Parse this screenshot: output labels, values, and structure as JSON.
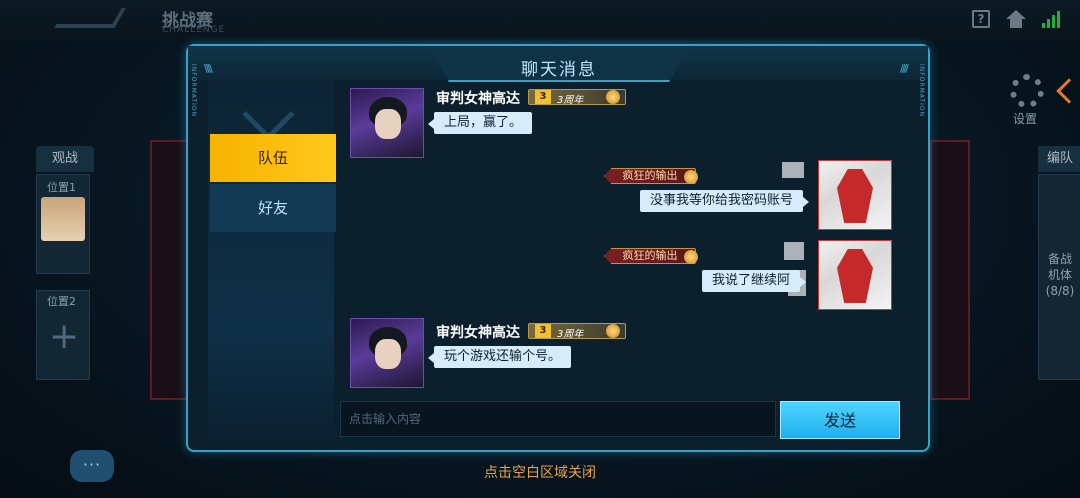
{
  "topbar": {
    "title": "挑战赛",
    "subtitle": "CHALLENGE",
    "help_label": "?",
    "signal_label": "82"
  },
  "left_panel": {
    "title": "观战",
    "slot1": "位置1",
    "slot2": "位置2"
  },
  "right_panel": {
    "title": "编队",
    "spare_label": "备战机体",
    "spare_count": "(8/8)",
    "settings_label": "设置"
  },
  "dialog": {
    "title": "聊天消息",
    "tabs": [
      {
        "label": "队伍",
        "active": true
      },
      {
        "label": "好友",
        "active": false
      }
    ],
    "messages": [
      {
        "sender": "审判女神高达",
        "badge_level": "3",
        "badge_text": "3周年",
        "text": "上局，赢了。",
        "side": "left"
      },
      {
        "badge_text": "疯狂的输出",
        "text": "没事我等你给我密码账号",
        "side": "right"
      },
      {
        "badge_text": "疯狂的输出",
        "text": "我说了继续阿",
        "side": "right"
      },
      {
        "sender": "审判女神高达",
        "badge_level": "3",
        "badge_text": "3周年",
        "text": "玩个游戏还输个号。",
        "side": "left"
      }
    ],
    "input_placeholder": "点击输入内容",
    "send_label": "发送"
  },
  "footer_hint": "点击空白区域关闭",
  "chat_icon_label": "···",
  "colors": {
    "accent": "#3aa0c6",
    "active_tab": "#f6b300",
    "send_button": "#2fc0f5",
    "hint": "#e7a24c"
  }
}
